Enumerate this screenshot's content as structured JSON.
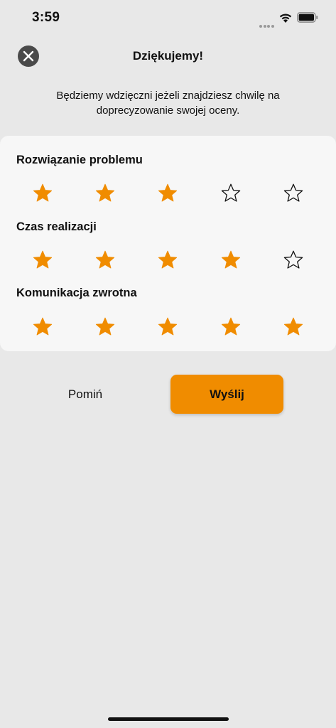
{
  "status_bar": {
    "time": "3:59"
  },
  "header": {
    "title": "Dziękujemy!",
    "close_icon": "close-icon"
  },
  "intro": {
    "text": "Będziemy wdzięczni jeżeli znajdziesz chwilę na doprecyzowanie swojej oceny."
  },
  "ratings": [
    {
      "label": "Rozwiązanie problemu",
      "value": 3,
      "max": 5
    },
    {
      "label": "Czas realizacji",
      "value": 4,
      "max": 5
    },
    {
      "label": "Komunikacja zwrotna",
      "value": 5,
      "max": 5
    }
  ],
  "actions": {
    "skip_label": "Pomiń",
    "send_label": "Wyślij"
  },
  "colors": {
    "accent": "#f08c00",
    "background": "#e8e8e8",
    "card": "#f7f7f7",
    "close_button": "#4a4a4a"
  }
}
